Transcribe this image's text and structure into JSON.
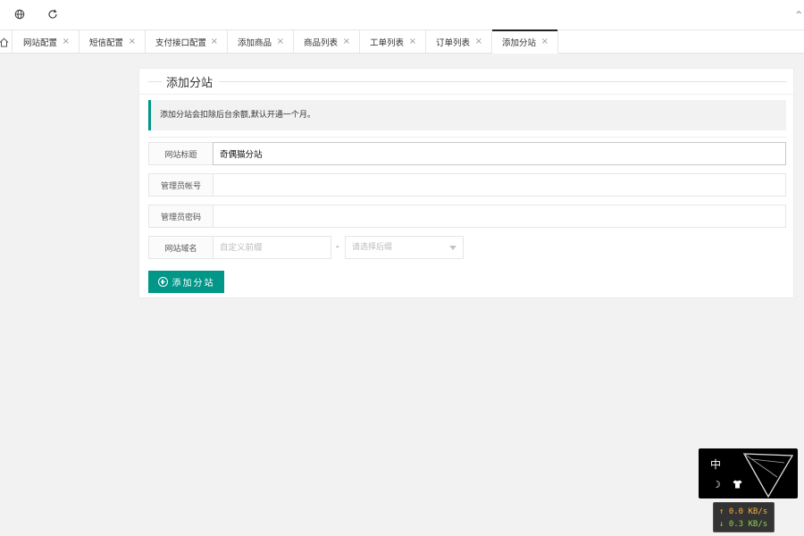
{
  "topbar": {
    "icons": [
      "globe-icon",
      "refresh-icon"
    ],
    "edge_mark": "^"
  },
  "tabs": {
    "home_icon": "home-icon",
    "items": [
      {
        "label": "网站配置",
        "active": false
      },
      {
        "label": "短信配置",
        "active": false
      },
      {
        "label": "支付接口配置",
        "active": false
      },
      {
        "label": "添加商品",
        "active": false
      },
      {
        "label": "商品列表",
        "active": false
      },
      {
        "label": "工单列表",
        "active": false
      },
      {
        "label": "订单列表",
        "active": false
      },
      {
        "label": "添加分站",
        "active": true
      }
    ],
    "close_glyph": "×"
  },
  "form": {
    "title": "添加分站",
    "notice": "添加分站会扣除后台余额,默认开通一个月。",
    "site_title": {
      "label": "网站标题",
      "value": "奇偶猫分站"
    },
    "admin_account": {
      "label": "管理员帐号",
      "value": ""
    },
    "admin_password": {
      "label": "管理员密码",
      "value": ""
    },
    "domain": {
      "label": "网站域名",
      "prefix_placeholder": "自定义前缀",
      "separator": "-",
      "suffix_placeholder": "请选择后缀"
    },
    "submit_label": "添加分站"
  },
  "widget": {
    "lang": "中",
    "moon_glyph": "☽",
    "shirt_glyph": "👕"
  },
  "speed": {
    "up": "↑ 0.0 KB/s",
    "down": "↓ 0.3 KB/s"
  },
  "colors": {
    "accent": "#009688",
    "upload": "#f7b23b",
    "download": "#8fd14f"
  }
}
